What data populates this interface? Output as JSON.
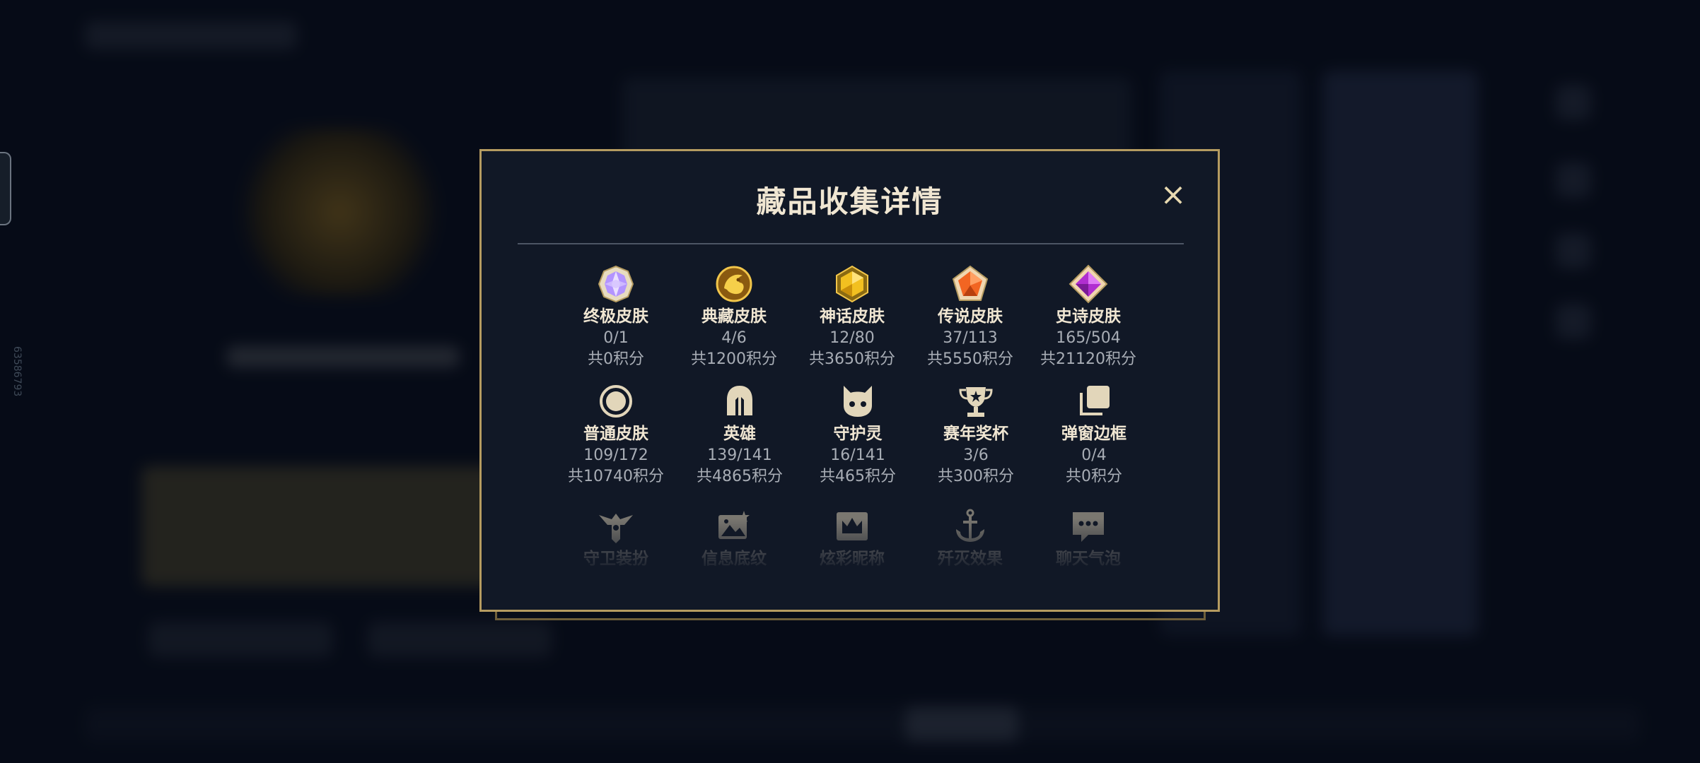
{
  "modal": {
    "title": "藏品收集详情",
    "close_icon": "×",
    "items": [
      {
        "label": "终极皮肤",
        "count": "0/1",
        "points": "共0积分",
        "icon": "ultimate-gem-icon",
        "color": "#c9a8ff"
      },
      {
        "label": "典藏皮肤",
        "count": "4/6",
        "points": "共1200积分",
        "icon": "prestige-dragon-icon",
        "color": "#e7a22a"
      },
      {
        "label": "神话皮肤",
        "count": "12/80",
        "points": "共3650积分",
        "icon": "mythic-gem-icon",
        "color": "#f2c020"
      },
      {
        "label": "传说皮肤",
        "count": "37/113",
        "points": "共5550积分",
        "icon": "legendary-gem-icon",
        "color": "#f26522"
      },
      {
        "label": "史诗皮肤",
        "count": "165/504",
        "points": "共21120积分",
        "icon": "epic-gem-icon",
        "color": "#c43ee0"
      },
      {
        "label": "普通皮肤",
        "count": "109/172",
        "points": "共10740积分",
        "icon": "standard-circle-icon",
        "color": "#d8ccb0"
      },
      {
        "label": "英雄",
        "count": "139/141",
        "points": "共4865积分",
        "icon": "helmet-icon",
        "color": "#d8ccb0"
      },
      {
        "label": "守护灵",
        "count": "16/141",
        "points": "共465积分",
        "icon": "little-legend-icon",
        "color": "#d8ccb0"
      },
      {
        "label": "赛年奖杯",
        "count": "3/6",
        "points": "共300积分",
        "icon": "trophy-icon",
        "color": "#d8ccb0"
      },
      {
        "label": "弹窗边框",
        "count": "0/4",
        "points": "共0积分",
        "icon": "frame-stack-icon",
        "color": "#d8ccb0"
      },
      {
        "label": "守卫装扮",
        "icon": "ward-skin-icon",
        "color": "#d8ccb0"
      },
      {
        "label": "信息底纹",
        "icon": "banner-icon",
        "color": "#d8ccb0"
      },
      {
        "label": "炫彩昵称",
        "icon": "crown-nameplate-icon",
        "color": "#d8ccb0"
      },
      {
        "label": "歼灭效果",
        "icon": "anchor-icon",
        "color": "#d8ccb0"
      },
      {
        "label": "聊天气泡",
        "icon": "chat-bubble-icon",
        "color": "#d8ccb0"
      }
    ]
  },
  "sidebar": {
    "id_text": "63586793"
  }
}
